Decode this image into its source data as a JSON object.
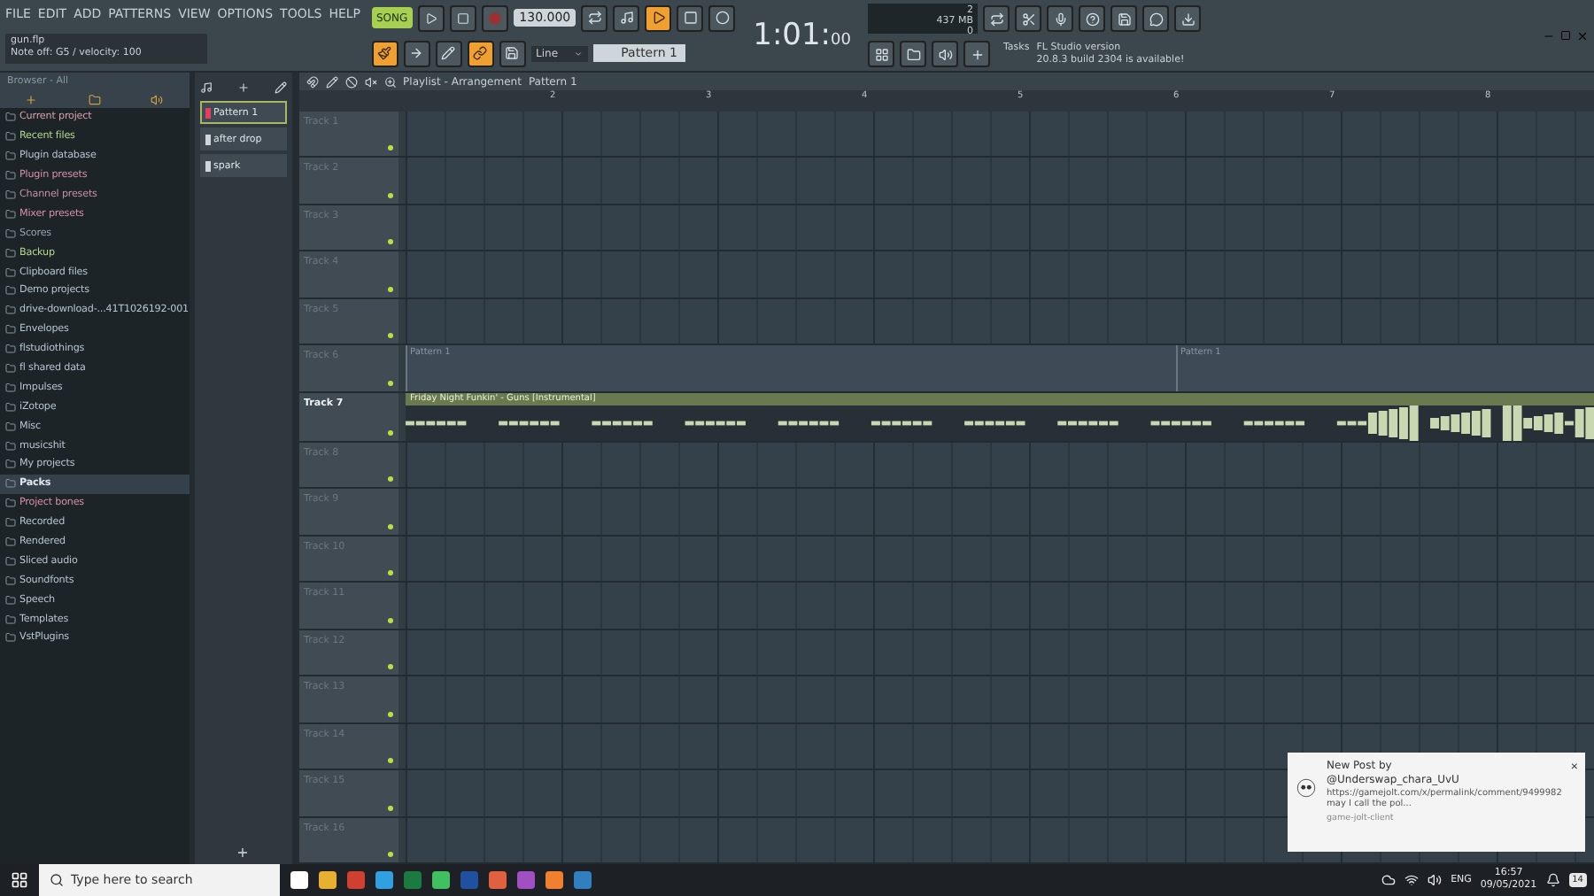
{
  "menu": [
    "FILE",
    "EDIT",
    "ADD",
    "PATTERNS",
    "VIEW",
    "OPTIONS",
    "TOOLS",
    "HELP"
  ],
  "hint": {
    "file": "gun.flp",
    "message": "Note off: G5 / velocity: 100"
  },
  "transport": {
    "mode": "SONG",
    "song_mode": true,
    "recording": false,
    "tempo": "130.000",
    "time": "1:01:",
    "time_sub": "00"
  },
  "toggles": [
    {
      "on": false
    },
    {
      "on": false
    },
    {
      "on": true
    },
    {
      "on": false
    },
    {
      "on": false
    }
  ],
  "tools2": [
    {
      "on": true
    },
    {
      "on": false
    },
    {
      "on": false
    },
    {
      "on": true
    },
    {
      "on": false
    }
  ],
  "snap": "Line",
  "pattern_selector": "Pattern 1",
  "cpu": {
    "voices": "2",
    "memory": "437 MB",
    "polyphony": "0"
  },
  "news": {
    "prefix": "Tasks",
    "line1": "FL Studio version",
    "line2": "20.8.3 build 2304 is available!"
  },
  "browser": {
    "title": "Browser - All",
    "items": [
      {
        "label": "Current project",
        "color": "#d8a0a8",
        "selected": false
      },
      {
        "label": "Recent files",
        "color": "#b8d890",
        "selected": false
      },
      {
        "label": "Plugin database",
        "color": "#b8c4d0",
        "selected": false
      },
      {
        "label": "Plugin presets",
        "color": "#d890a8",
        "selected": false
      },
      {
        "label": "Channel presets",
        "color": "#c890a8",
        "selected": false
      },
      {
        "label": "Mixer presets",
        "color": "#d890a8",
        "selected": false
      },
      {
        "label": "Scores",
        "color": "#98a4b0",
        "selected": false
      },
      {
        "label": "Backup",
        "color": "#b8d890",
        "selected": false
      },
      {
        "label": "Clipboard files",
        "color": "#b8c4d0",
        "selected": false
      },
      {
        "label": "Demo projects",
        "color": "#b8c4d0",
        "selected": false
      },
      {
        "label": "drive-download-...41T1026192-001",
        "color": "#b8c4d0",
        "selected": false
      },
      {
        "label": "Envelopes",
        "color": "#b8c4d0",
        "selected": false
      },
      {
        "label": "flstudiothings",
        "color": "#b8c4d0",
        "selected": false
      },
      {
        "label": "fl shared data",
        "color": "#b8c4d0",
        "selected": false
      },
      {
        "label": "Impulses",
        "color": "#b8c4d0",
        "selected": false
      },
      {
        "label": "iZotope",
        "color": "#b8c4d0",
        "selected": false
      },
      {
        "label": "Misc",
        "color": "#b8c4d0",
        "selected": false
      },
      {
        "label": "musicshit",
        "color": "#b8c4d0",
        "selected": false
      },
      {
        "label": "My projects",
        "color": "#b8c4d0",
        "selected": false
      },
      {
        "label": "Packs",
        "color": "#dfe6ee",
        "selected": true
      },
      {
        "label": "Project bones",
        "color": "#d890a8",
        "selected": false
      },
      {
        "label": "Recorded",
        "color": "#b8c4d0",
        "selected": false
      },
      {
        "label": "Rendered",
        "color": "#b8c4d0",
        "selected": false
      },
      {
        "label": "Sliced audio",
        "color": "#b8c4d0",
        "selected": false
      },
      {
        "label": "Soundfonts",
        "color": "#b8c4d0",
        "selected": false
      },
      {
        "label": "Speech",
        "color": "#b8c4d0",
        "selected": false
      },
      {
        "label": "Templates",
        "color": "#b8c4d0",
        "selected": false
      },
      {
        "label": "VstPlugins",
        "color": "#b8c4d0",
        "selected": false
      }
    ]
  },
  "patterns": [
    {
      "label": "Pattern 1",
      "selected": true
    },
    {
      "label": "after drop",
      "selected": false
    },
    {
      "label": "spark",
      "selected": false
    }
  ],
  "picker_add": "+",
  "playlist": {
    "title": "Playlist - Arrangement",
    "crumb": "Pattern 1",
    "bars": [
      "2",
      "3",
      "4",
      "5",
      "6",
      "7",
      "8"
    ],
    "tracks": [
      {
        "name": "Track 1",
        "selected": false,
        "on": true
      },
      {
        "name": "Track 2",
        "selected": false,
        "on": true
      },
      {
        "name": "Track 3",
        "selected": false,
        "on": true
      },
      {
        "name": "Track 4",
        "selected": false,
        "on": true
      },
      {
        "name": "Track 5",
        "selected": false,
        "on": true
      },
      {
        "name": "Track 6",
        "selected": false,
        "on": true,
        "clips": [
          {
            "kind": "pattern",
            "label": "Pattern 1"
          },
          {
            "kind": "pattern",
            "label": "Pattern 1"
          }
        ]
      },
      {
        "name": "Track 7",
        "selected": true,
        "on": true,
        "clips": [
          {
            "kind": "audio",
            "label": "Friday Night Funkin' - Guns [Instrumental]"
          }
        ]
      },
      {
        "name": "Track 8",
        "selected": false,
        "on": true
      },
      {
        "name": "Track 9",
        "selected": false,
        "on": true
      },
      {
        "name": "Track 10",
        "selected": false,
        "on": true
      },
      {
        "name": "Track 11",
        "selected": false,
        "on": true
      },
      {
        "name": "Track 12",
        "selected": false,
        "on": true
      },
      {
        "name": "Track 13",
        "selected": false,
        "on": true
      },
      {
        "name": "Track 14",
        "selected": false,
        "on": true
      },
      {
        "name": "Track 15",
        "selected": false,
        "on": true
      },
      {
        "name": "Track 16",
        "selected": false,
        "on": true
      }
    ]
  },
  "notification": {
    "title": "New Post by",
    "author": "@Underswap_chara_UvU",
    "body": "https://gamejolt.com/x/permalink/comment/9499982 may I call the pol...",
    "source": "game-jolt-client",
    "close": "×"
  },
  "taskbar": {
    "search_placeholder": "Type here to search",
    "language": "ENG",
    "time": "16:57",
    "date": "09/05/2021",
    "badge": "14"
  }
}
